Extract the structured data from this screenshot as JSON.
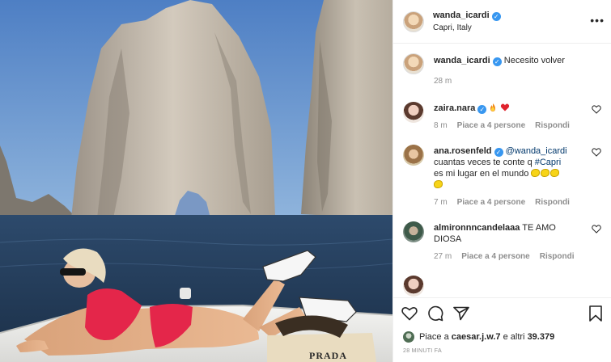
{
  "post": {
    "author": "wanda_icardi",
    "location": "Capri, Italy",
    "more_icon": "more-options-icon"
  },
  "caption": {
    "username": "wanda_icardi",
    "text": "Necesito volver",
    "time": "28 m"
  },
  "comments": [
    {
      "username": "zaira.nara",
      "verified": true,
      "emoji": [
        "fire-emoji",
        "red-heart-emoji"
      ],
      "time": "8 m",
      "likes": "Piace a 4 persone",
      "reply": "Rispondi"
    },
    {
      "username": "ana.rosenfeld",
      "verified": true,
      "mention": "@wanda_icardi",
      "text_line1": "cuantas veces te conte q",
      "hashtag": "#Capri",
      "text_line2": "es mi lugar en el mundo",
      "emoji": [
        "lemon-emoji",
        "lemon-emoji",
        "lemon-emoji",
        "lemon-emoji"
      ],
      "time": "7 m",
      "likes": "Piace a 4 persone",
      "reply": "Rispondi"
    },
    {
      "username": "almironnncandelaaa",
      "text": "TE AMO DIOSA",
      "time": "27 m",
      "likes": "Piace a 4 persone",
      "reply": "Rispondi"
    }
  ],
  "actions": {
    "like_icon": "heart-icon",
    "comment_icon": "comment-icon",
    "share_icon": "share-icon",
    "save_icon": "bookmark-icon"
  },
  "liked_by": {
    "prefix": "Piace a ",
    "user": "caesar.j.w.7",
    "middle": " e altri ",
    "count": "39.379"
  },
  "timestamp": "28 MINUTI FA",
  "photo": {
    "bag_text": "PRADA"
  },
  "colors": {
    "verified": "#3897f0",
    "link": "#00376b",
    "muted": "#8e8e8e"
  }
}
